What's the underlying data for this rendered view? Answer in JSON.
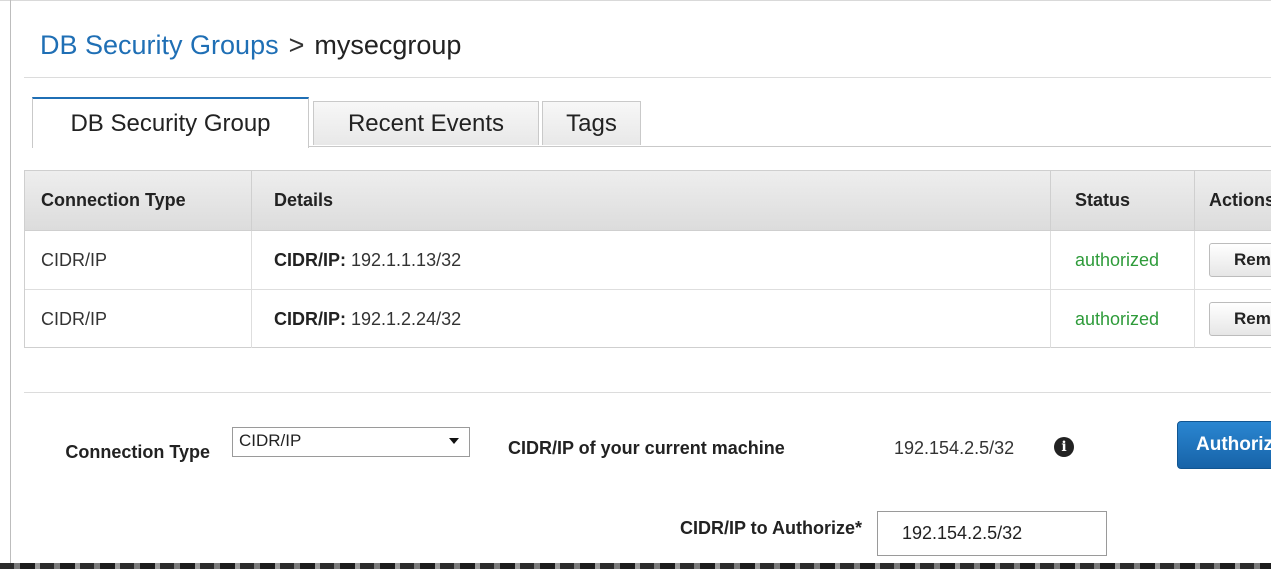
{
  "breadcrumb": {
    "parent": "DB Security Groups",
    "separator": ">",
    "current": "mysecgroup"
  },
  "tabs": [
    {
      "label": "DB Security Group",
      "active": true
    },
    {
      "label": "Recent Events",
      "active": false
    },
    {
      "label": "Tags",
      "active": false
    }
  ],
  "table": {
    "headers": [
      "Connection Type",
      "Details",
      "Status",
      "Actions"
    ],
    "rows": [
      {
        "connection_type": "CIDR/IP",
        "details_key": "CIDR/IP:",
        "details_value": "192.1.1.13/32",
        "status": "authorized",
        "action": "Remove"
      },
      {
        "connection_type": "CIDR/IP",
        "details_key": "CIDR/IP:",
        "details_value": "192.1.2.24/32",
        "status": "authorized",
        "action": "Remove"
      }
    ]
  },
  "form": {
    "connection_type_label": "Connection Type",
    "connection_type_value": "CIDR/IP",
    "current_machine_label": "CIDR/IP of your current machine",
    "current_machine_value": "192.154.2.5/32",
    "authorize_button": "Authorize",
    "cidr_label": "CIDR/IP to Authorize*",
    "cidr_value": "192.154.2.5/32"
  },
  "colors": {
    "link": "#1f6fb5",
    "status_authorized": "#2e9b3a",
    "primary_button": "#1f74bd"
  },
  "icons": {
    "info": "info-circle-icon",
    "dropdown": "chevron-down-icon"
  }
}
